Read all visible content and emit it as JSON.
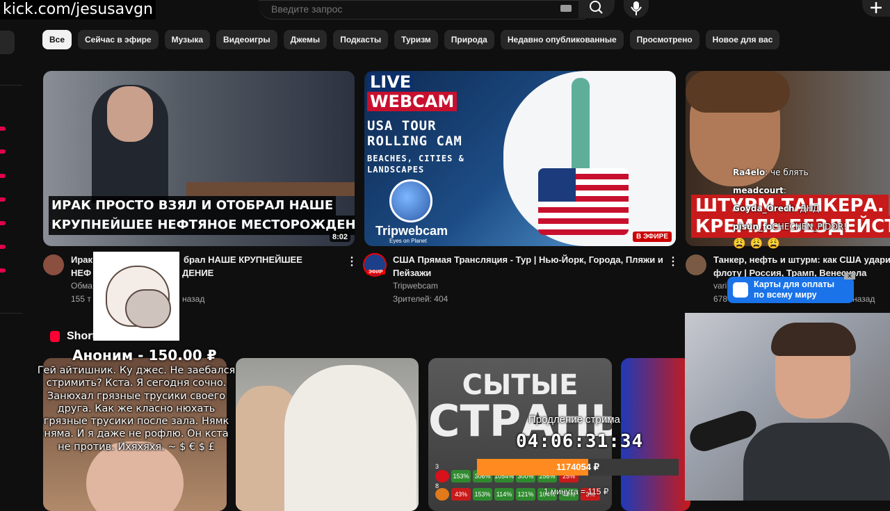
{
  "header": {
    "url": "kick.com/jesusavgn",
    "search_placeholder": "Введите запрос"
  },
  "chips": [
    "Все",
    "Сейчас в эфире",
    "Музыка",
    "Видеоигры",
    "Джемы",
    "Подкасты",
    "Туризм",
    "Природа",
    "Недавно опубликованные",
    "Просмотрено",
    "Новое для вас"
  ],
  "videos": [
    {
      "thumb_line1": "ИРАК ПРОСТО ВЗЯЛ И ОТОБРАЛ НАШЕ",
      "thumb_line2": "КРУПНЕЙШЕЕ НЕФТЯНОЕ МЕСТОРОЖДЕНИЕ",
      "duration": "8:02",
      "title_line1_left": "Ирак",
      "title_line1_right": "брал НАШЕ КРУПНЕЙШЕЕ",
      "title_line2_left": "НЕФ",
      "title_line2_right": "ДЕНИЕ",
      "channel": "Обма",
      "views": "155 т",
      "age": "назад"
    },
    {
      "live_label": "LIVE",
      "webcam_label": "WEBCAM",
      "tour_line1": "USA TOUR",
      "tour_line2": "ROLLING CAM",
      "tour_line3": "BEACHES, CITIES & LANDSCAPES",
      "brand": "Tripwebcam",
      "brand_sub": "Eyes on Planet",
      "live_badge": "В ЭФИРЕ",
      "avatar_badge": "ЭФИР",
      "title_line1": "США Прямая Трансляция - Тур | Нью-Йорк, Города, Пляжи и",
      "title_line2": "Пейзажи",
      "channel": "Tripwebcam",
      "viewers": "Зрителей: 404"
    },
    {
      "thumb_line1": "ШТУРМ ТАНКЕРА.",
      "thumb_line2": "КРЕМЛЬ БЕЗДЕЙСТ",
      "title_line1": "Танкер, нефть и штурм: как США удари",
      "title_line2": "флоту | Россия, Трамп, Венесуэла",
      "channel": "vari",
      "views": "678",
      "age": "назад"
    }
  ],
  "shorts": {
    "label": "Shorts",
    "card3_line1": "СЫТЫЕ",
    "card3_line2": "СТРАНЫ"
  },
  "donation": {
    "name_amount": "Аноним - 150.00 ₽",
    "message": "Гей айтишник. Ку джес. Не заебался стримить? Кста. Я сегодня сочно. Занюхал грязные трусики своего друга. Как же класно нюхать грязные трусики после зала. Нямк няма. И я даже не рофлю. Он кста не против. Ихяхяхя. ~ $ € $ £"
  },
  "chat": [
    {
      "name": "Ra4elo",
      "text": ": че блять"
    },
    {
      "name": "meadcourt",
      "text": ":"
    },
    {
      "name": "Goyda_Orech",
      "text": ": ДНД"
    },
    {
      "name": "pisun_fo",
      "text": "CHECHEN_PIDOR!"
    }
  ],
  "chat_emojis": "😩😩😩",
  "ad": {
    "line1": "Карты для оплаты",
    "line2": "по всему миру",
    "close": "✕"
  },
  "stream_timer": {
    "label": "Продление стрима",
    "value": "04:06:31:34",
    "goal": "1174054 ₽",
    "goal_progress": 0.55,
    "footer": "1 минута = 115 ₽"
  },
  "stats_row1": [
    "153%",
    "306%",
    "1054%",
    "300%",
    "256%",
    "25%"
  ],
  "stats_row2": [
    "43%",
    "153%",
    "114%",
    "121%",
    "104%",
    "40%",
    "3%"
  ],
  "stats_row_labels": [
    "3",
    "8"
  ],
  "colors": {
    "background": "#0f0f0f",
    "chip_bg": "#272727",
    "chip_active_bg": "#f1f1f1",
    "live_red": "#cc0000",
    "ad_blue": "#1a73e8",
    "goal_orange": "#ff8a1f"
  }
}
